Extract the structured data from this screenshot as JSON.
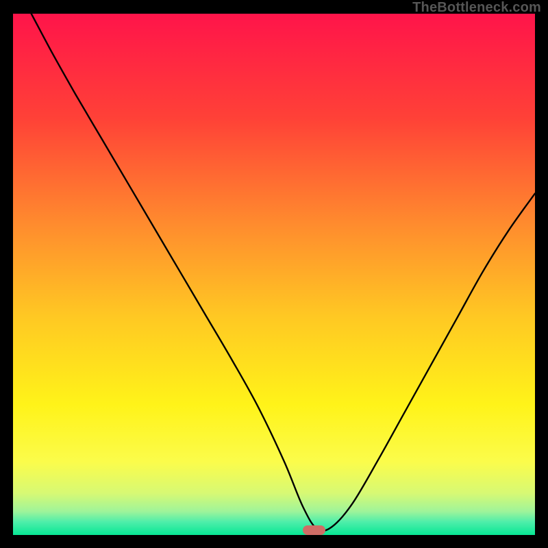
{
  "watermark": "TheBottleneck.com",
  "marker": {
    "x_frac": 0.577,
    "y_frac": 0.991,
    "w": 33,
    "h": 14,
    "color": "#cf6d66"
  },
  "gradient_stops": [
    {
      "pos": 0.0,
      "color": "#ff144a"
    },
    {
      "pos": 0.2,
      "color": "#ff4137"
    },
    {
      "pos": 0.4,
      "color": "#ff8a2e"
    },
    {
      "pos": 0.58,
      "color": "#ffc823"
    },
    {
      "pos": 0.75,
      "color": "#fff319"
    },
    {
      "pos": 0.86,
      "color": "#fbfc4b"
    },
    {
      "pos": 0.92,
      "color": "#d7f974"
    },
    {
      "pos": 0.955,
      "color": "#9ef49a"
    },
    {
      "pos": 0.975,
      "color": "#4eeeaa"
    },
    {
      "pos": 1.0,
      "color": "#07e794"
    }
  ],
  "chart_data": {
    "type": "line",
    "title": "",
    "xlabel": "",
    "ylabel": "",
    "xlim": [
      0,
      1
    ],
    "ylim": [
      0,
      1
    ],
    "series": [
      {
        "name": "bottleneck-curve",
        "x": [
          0.035,
          0.075,
          0.12,
          0.17,
          0.22,
          0.27,
          0.32,
          0.37,
          0.42,
          0.47,
          0.52,
          0.555,
          0.582,
          0.61,
          0.65,
          0.7,
          0.75,
          0.8,
          0.85,
          0.9,
          0.95,
          1.0
        ],
        "y": [
          1.0,
          0.925,
          0.845,
          0.76,
          0.675,
          0.59,
          0.505,
          0.42,
          0.335,
          0.245,
          0.14,
          0.055,
          0.012,
          0.015,
          0.06,
          0.145,
          0.235,
          0.325,
          0.415,
          0.505,
          0.585,
          0.655
        ]
      }
    ]
  }
}
